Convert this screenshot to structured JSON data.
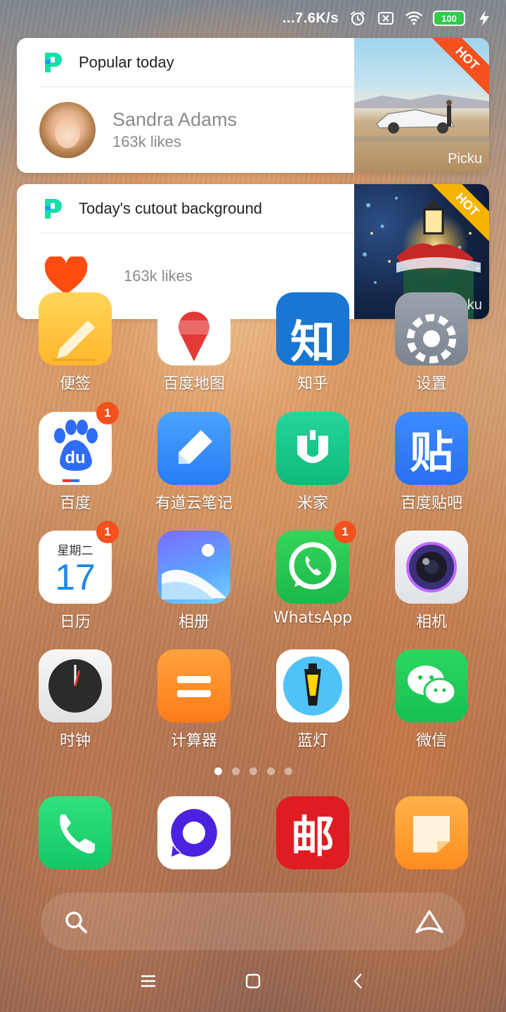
{
  "status_bar": {
    "network_speed": "...7.6K/s",
    "battery_level": "100",
    "icons": [
      "alarm-icon",
      "sim-disabled-icon",
      "wifi-icon",
      "battery-icon",
      "charging-icon"
    ]
  },
  "widgets": [
    {
      "title": "Popular today",
      "name": "Sandra Adams",
      "likes": "163k likes",
      "badge": "HOT",
      "thumb_label": "Picku"
    },
    {
      "title": "Today's cutout background",
      "likes": "163k likes",
      "badge": "HOT",
      "thumb_label": "Picku"
    }
  ],
  "apps": {
    "row0": [
      "便签",
      "百度地图",
      "知乎",
      "设置"
    ],
    "row1": [
      "百度",
      "有道云笔记",
      "米家",
      "百度贴吧"
    ],
    "row2": [
      "日历",
      "相册",
      "WhatsApp",
      "相机"
    ],
    "row3": [
      "时钟",
      "计算器",
      "蓝灯",
      "微信"
    ]
  },
  "badges": {
    "baidu": "1",
    "calendar": "1",
    "whatsapp": "1"
  },
  "calendar_icon": {
    "weekday": "星期二",
    "day": "17"
  },
  "icon_text": {
    "zhihu": "知",
    "tieba": "贴",
    "post": "邮",
    "baidu_du": "du"
  },
  "page_indicator": {
    "pages": 5,
    "active": 0
  },
  "colors": {
    "badge": "#f4511e",
    "hot_red": "#f4511e",
    "hot_yellow": "#f6b400",
    "accent_green": "#1de9b6"
  }
}
